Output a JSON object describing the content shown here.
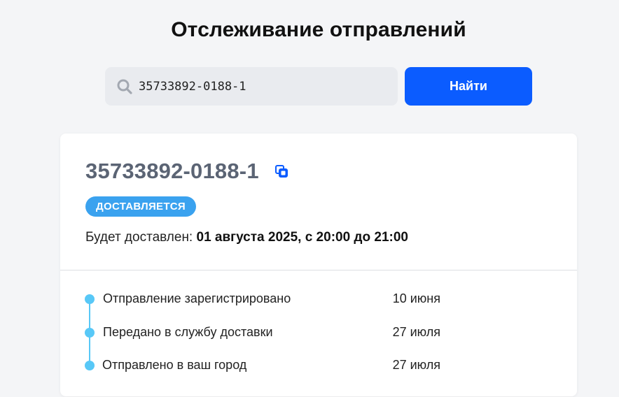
{
  "header": {
    "title": "Отслеживание отправлений"
  },
  "search": {
    "icon": "search-icon",
    "value": "35733892-0188-1",
    "button_label": "Найти"
  },
  "shipment": {
    "tracking_number": "35733892-0188-1",
    "copy_icon": "copy-icon",
    "status": "ДОСТАВЛЯЕТСЯ",
    "delivery_label": "Будет доставлен: ",
    "delivery_value": "01 августа 2025, с 20:00 до 21:00"
  },
  "timeline": {
    "events": [
      {
        "label": "Отправление зарегистрировано",
        "date": "10 июня"
      },
      {
        "label": "Передано в службу доставки",
        "date": "27 июля"
      },
      {
        "label": "Отправлено в ваш город",
        "date": "27 июля"
      }
    ]
  },
  "colors": {
    "accent": "#0b5cff",
    "status_badge": "#3aa2ef",
    "timeline": "#58c8f7",
    "tracking_number": "#5b6474"
  }
}
